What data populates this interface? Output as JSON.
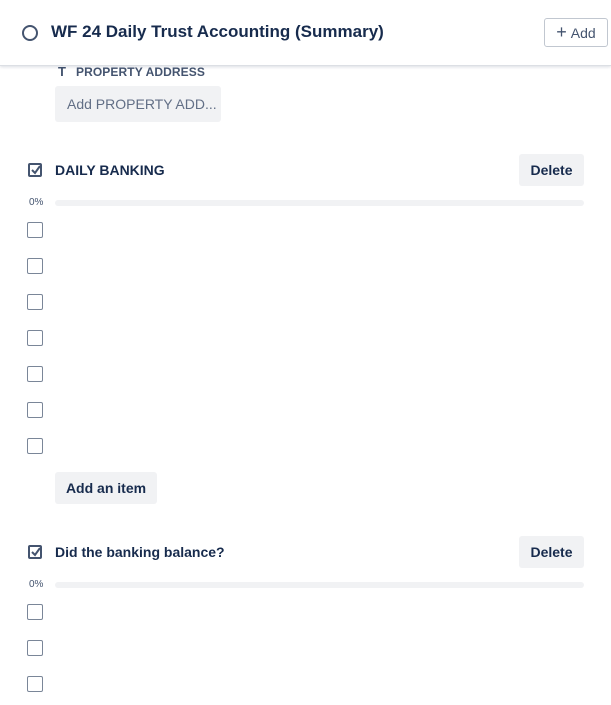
{
  "header": {
    "title": "WF 24 Daily Trust Accounting (Summary)",
    "add_label": "Add"
  },
  "custom_field": {
    "label": "PROPERTY ADDRESS",
    "placeholder": "Add PROPERTY ADD..."
  },
  "checklists": [
    {
      "title": "DAILY BANKING",
      "delete_label": "Delete",
      "progress_text": "0%",
      "progress": 0,
      "item_count": 7,
      "add_item_label": "Add an item"
    },
    {
      "title": "Did the banking balance?",
      "delete_label": "Delete",
      "progress_text": "0%",
      "progress": 0
    }
  ],
  "colors": {
    "text": "#172b4d",
    "button_bg": "#f1f2f4",
    "progress_fill": "#4bce97"
  }
}
